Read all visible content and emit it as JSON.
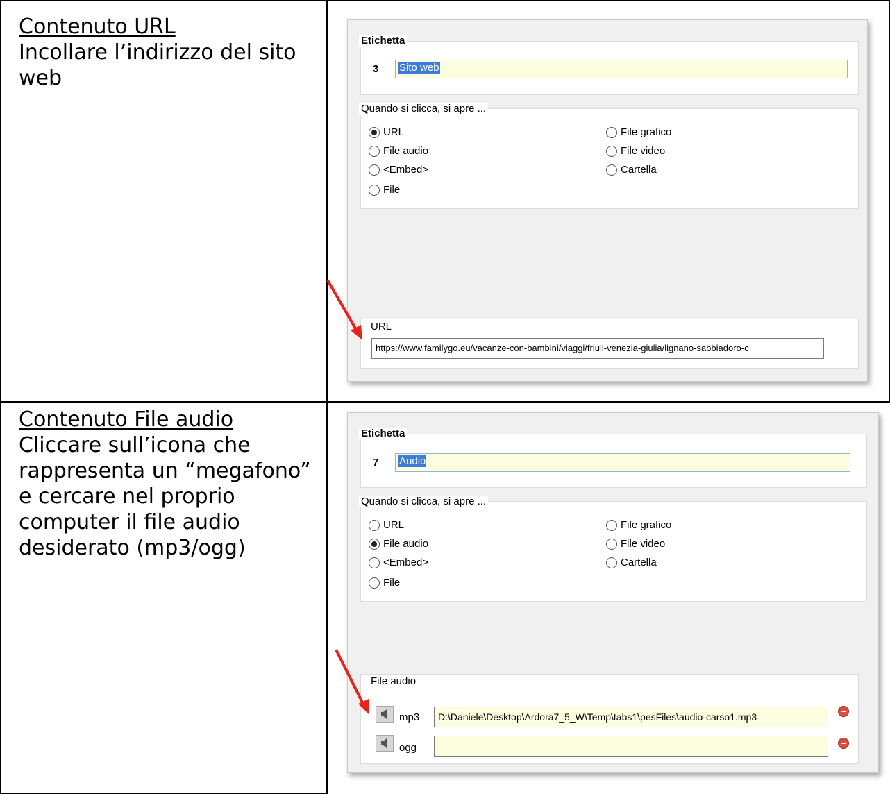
{
  "rows": [
    {
      "title": "Contenuto URL",
      "description": "Incollare l’indirizzo del sito web",
      "panel": {
        "label_group_title": "Etichetta",
        "number": "3",
        "label_value": "Sito web",
        "options_group_title": "Quando si clicca, si apre ...",
        "options": [
          {
            "label": "URL",
            "selected": true
          },
          {
            "label": "File audio",
            "selected": false
          },
          {
            "label": "<Embed>",
            "selected": false
          },
          {
            "label": "File",
            "selected": false
          },
          {
            "label": "File grafico",
            "selected": false
          },
          {
            "label": "File video",
            "selected": false
          },
          {
            "label": "Cartella",
            "selected": false
          }
        ],
        "content_group_title": "URL",
        "url_value": "https://www.familygo.eu/vacanze-con-bambini/viaggi/friuli-venezia-giulia/lignano-sabbiadoro-c"
      }
    },
    {
      "title": "Contenuto File audio",
      "description": "Cliccare sull’icona che rappresenta un “megafono” e cercare nel proprio computer il file audio desiderato (mp3/ogg)",
      "panel": {
        "label_group_title": "Etichetta",
        "number": "7",
        "label_value": "Audio",
        "options_group_title": "Quando si clicca, si apre ...",
        "options": [
          {
            "label": "URL",
            "selected": false
          },
          {
            "label": "File audio",
            "selected": true
          },
          {
            "label": "<Embed>",
            "selected": false
          },
          {
            "label": "File",
            "selected": false
          },
          {
            "label": "File grafico",
            "selected": false
          },
          {
            "label": "File video",
            "selected": false
          },
          {
            "label": "Cartella",
            "selected": false
          }
        ],
        "content_group_title": "File audio",
        "files": [
          {
            "ext": "mp3",
            "path": "D:\\Daniele\\Desktop\\Ardora7_5_W\\Temp\\tabs1\\pesFiles\\audio-carso1.mp3"
          },
          {
            "ext": "ogg",
            "path": ""
          }
        ]
      }
    }
  ],
  "colors": {
    "arrow": "#e8231c",
    "input_fill": "#fdfde0",
    "selection": "#3d7dd8"
  },
  "icons": {
    "speaker": "speaker-icon",
    "remove": "remove-icon",
    "arrow": "red-arrow-icon"
  }
}
